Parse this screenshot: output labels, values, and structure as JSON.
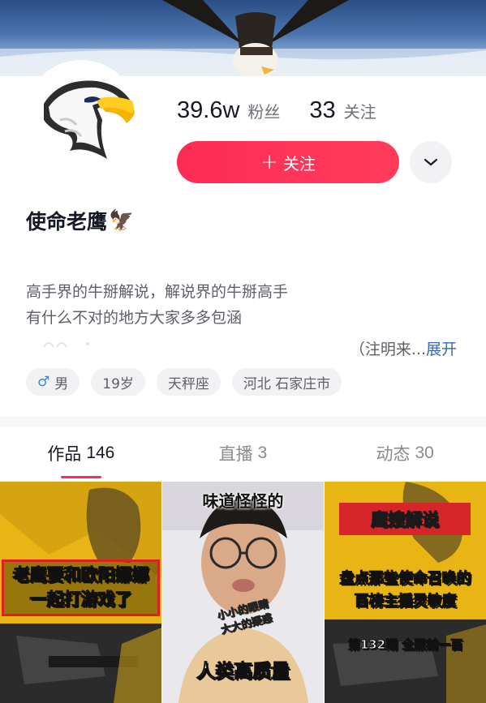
{
  "profile": {
    "name": "使命老鹰",
    "name_emoji": "🦅",
    "stats": {
      "followers_value": "39.6w",
      "followers_label": "粉丝",
      "following_value": "33",
      "following_label": "关注"
    },
    "follow_button_label": "关注",
    "bio_lines": [
      "高手界的牛掰解说，解说界的牛掰高手",
      "有什么不对的地方大家多多包涵"
    ],
    "bio_continued": "（注明来...",
    "expand_label": "展开",
    "tags": {
      "gender": "男",
      "gender_icon": "male-icon",
      "age": "19岁",
      "zodiac": "天秤座",
      "location": "河北 石家庄市"
    },
    "accent_color": "#fe2c55"
  },
  "tabs": [
    {
      "label": "作品",
      "count": "146",
      "active": true
    },
    {
      "label": "直播",
      "count": "3",
      "active": false
    },
    {
      "label": "动态",
      "count": "30",
      "active": false
    }
  ],
  "videos": [
    {
      "caption_lines": [
        "老鹰要和欧阳娜娜",
        "一起打游戏了"
      ]
    },
    {
      "top_text": "味道怪怪的",
      "middle_lines": [
        "小小的眼睛",
        "大大的疑惑"
      ],
      "bottom_text": "人类高质量"
    },
    {
      "badge": "鹰嫂解说",
      "caption_lines": [
        "盘点那些使命召唤的",
        "百榜主播灵敏度"
      ],
      "footer": "第132期 全服前一百"
    }
  ]
}
